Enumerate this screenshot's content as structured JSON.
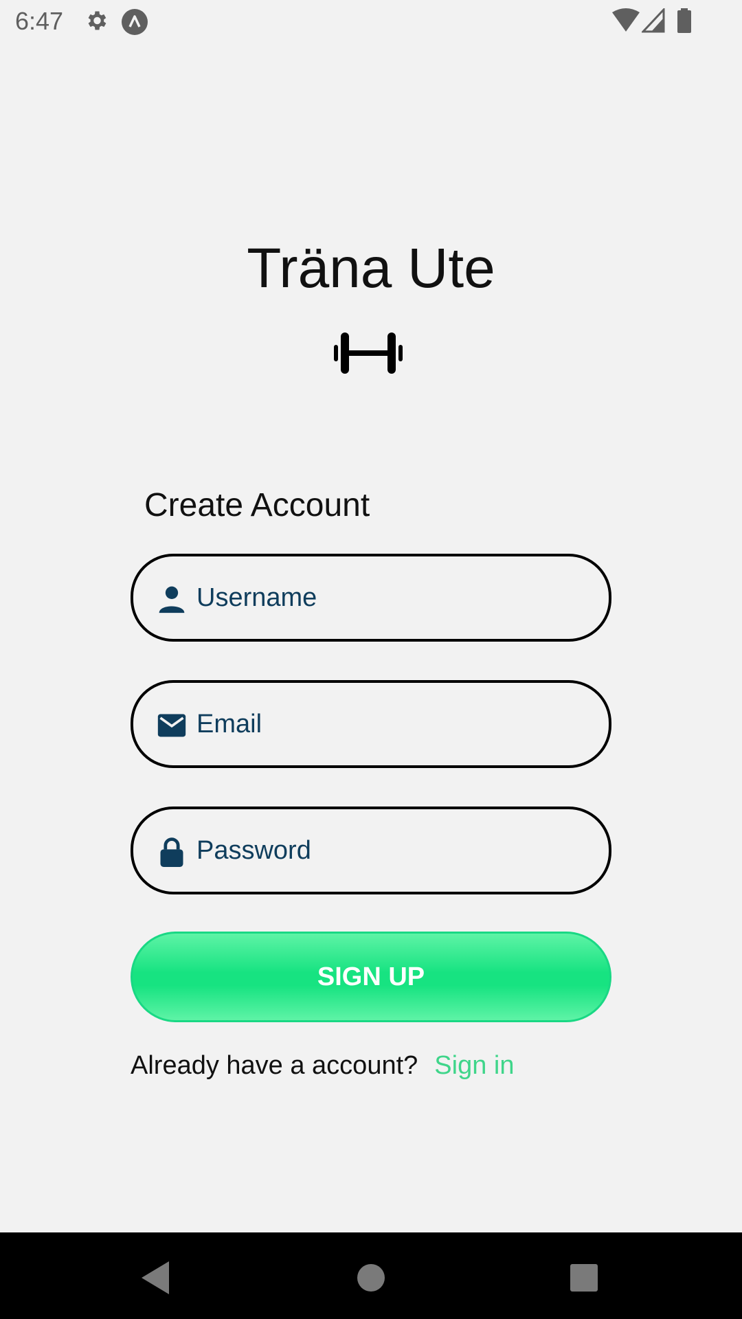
{
  "status_bar": {
    "time": "6:47",
    "icons": [
      "settings-icon",
      "app-notification-icon",
      "wifi-icon",
      "cellular-signal-icon",
      "battery-icon"
    ]
  },
  "app": {
    "title": "Träna Ute",
    "logo_icon": "dumbbell-icon"
  },
  "form": {
    "heading": "Create Account",
    "username": {
      "placeholder": "Username",
      "value": "",
      "icon": "person-icon"
    },
    "email": {
      "placeholder": "Email",
      "value": "",
      "icon": "mail-icon"
    },
    "password": {
      "placeholder": "Password",
      "value": "",
      "icon": "lock-icon"
    },
    "submit_label": "SIGN UP",
    "signin_prompt": "Already have a account?",
    "signin_link": "Sign in"
  },
  "nav": {
    "buttons": [
      "back-icon",
      "home-icon",
      "recents-icon"
    ]
  },
  "colors": {
    "background": "#f2f2f2",
    "accent": "#17e381",
    "link": "#3fd58a",
    "input_text": "#0f3d5c"
  }
}
